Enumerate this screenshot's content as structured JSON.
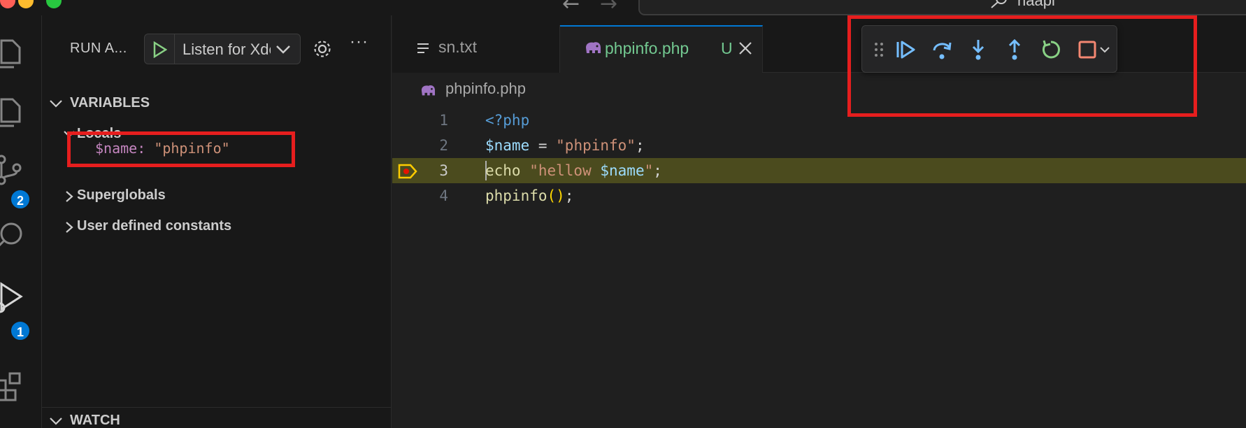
{
  "titlebar": {
    "search_text": "naapi"
  },
  "activity_bar": {
    "items": [
      {
        "icon": "explorer-icon"
      },
      {
        "icon": "files-icon"
      },
      {
        "icon": "source-control-icon",
        "badge": "2"
      },
      {
        "icon": "search-icon"
      },
      {
        "icon": "run-debug-icon",
        "badge": "1"
      },
      {
        "icon": "extensions-icon"
      }
    ]
  },
  "sidebar": {
    "title": "RUN A...",
    "launch_config": "Listen for Xdebug",
    "sections": {
      "variables": "VARIABLES",
      "locals": "Locals",
      "superglobals": "Superglobals",
      "user_constants": "User defined constants",
      "watch": "WATCH"
    },
    "locals_vars": [
      {
        "name": "$name",
        "value": "\"phpinfo\""
      }
    ]
  },
  "editor": {
    "tabs": [
      {
        "label": "sn.txt",
        "icon": "text-file-icon"
      },
      {
        "label": "phpinfo.php",
        "icon": "php-elephant-icon",
        "status": "U",
        "active": true
      }
    ],
    "breadcrumb": "phpinfo.php",
    "debug_toolbar": [
      "drag-handle-icon",
      "continue-icon",
      "step-over-icon",
      "step-into-icon",
      "step-out-icon",
      "restart-icon",
      "stop-icon",
      "chevron-down-icon"
    ],
    "code_lines": [
      {
        "num": "1",
        "open_tag": "<?php"
      },
      {
        "num": "2",
        "var": "$name",
        "op": " = ",
        "str": "\"phpinfo\"",
        "end": ";"
      },
      {
        "num": "3",
        "kw": "echo",
        "str_open": " \"hellow ",
        "str_var": "$name",
        "str_close": "\"",
        "end": ";"
      },
      {
        "num": "4",
        "fn": "phpinfo",
        "paren": "()",
        "end": ";"
      }
    ]
  },
  "colors": {
    "highlight_box": "#e61e1e",
    "accent": "#0078d4",
    "current_line": "#4b4b1e"
  }
}
